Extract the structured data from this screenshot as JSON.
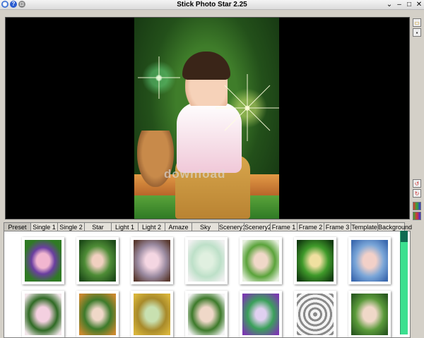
{
  "window": {
    "title": "Stick Photo Star 2.25",
    "buttons": [
      "⌄",
      "–",
      "□",
      "✕"
    ]
  },
  "viewer": {
    "watermark": "download"
  },
  "side_toolbar": [
    "open-icon",
    "save-icon",
    "undo-icon",
    "redo-icon",
    "color-icon",
    "effects-icon"
  ],
  "tabs": [
    {
      "label": "Preset",
      "active": true
    },
    {
      "label": "Single 1"
    },
    {
      "label": "Single 2"
    },
    {
      "label": "Star"
    },
    {
      "label": "Light 1"
    },
    {
      "label": "Light 2"
    },
    {
      "label": "Amaze"
    },
    {
      "label": "Sky"
    },
    {
      "label": "Scenery1"
    },
    {
      "label": "Scenery2"
    },
    {
      "label": "Frame 1"
    },
    {
      "label": "Frame 2"
    },
    {
      "label": "Frame 3"
    },
    {
      "label": "Template"
    },
    {
      "label": "Background"
    }
  ],
  "colors": {
    "accent_scroll": "#3be090",
    "window_bg": "#d4d0c8"
  }
}
